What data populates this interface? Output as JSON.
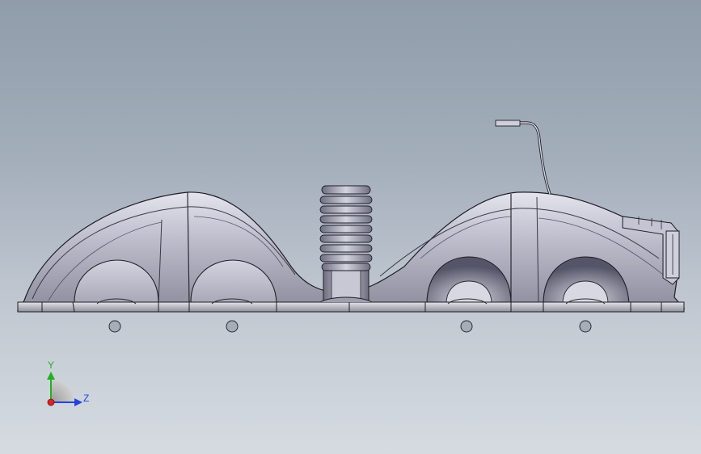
{
  "viewport": {
    "background_top": "#8f9caa",
    "background_bottom": "#d6dbe1"
  },
  "model": {
    "body_color": "#b4b4c4",
    "shadow_color": "#6e6e80",
    "edge_color": "#1e1e26",
    "bolt_hole_count": 4
  },
  "triad": {
    "y_label": "Y",
    "z_label": "Z",
    "y_color": "#22b022",
    "z_color": "#2244dd",
    "x_color": "#dd2222"
  }
}
